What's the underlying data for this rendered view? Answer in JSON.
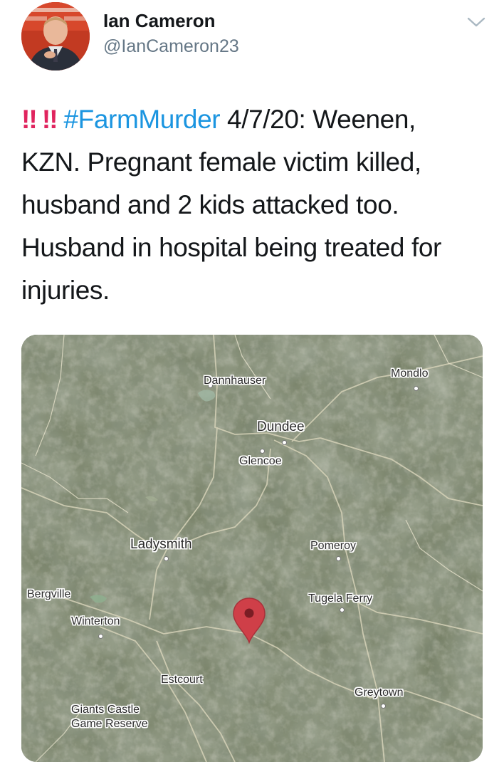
{
  "user": {
    "display_name": "Ian Cameron",
    "handle": "@IanCameron23"
  },
  "tweet": {
    "bang": "!! !!",
    "hashtag": "#FarmMurder",
    "line1_rest": " 4/7/20: Weenen,",
    "line2": "KZN. Pregnant female victim killed,",
    "line3": "husband and 2 kids attacked too.",
    "line4": "Husband in hospital being treated for",
    "line5": "injuries."
  },
  "map": {
    "labels": {
      "dannhauser": "Dannhauser",
      "mondlo": "Mondlo",
      "dundee": "Dundee",
      "glencoe": "Glencoe",
      "ladysmith": "Ladysmith",
      "pomeroy": "Pomeroy",
      "bergville": "Bergville",
      "tugela_ferry": "Tugela Ferry",
      "winterton": "Winterton",
      "estcourt": "Estcourt",
      "greytown": "Greytown",
      "giants_castle_1": "Giants Castle",
      "giants_castle_2": "Game Reserve"
    },
    "pin_color": "#d0414a"
  },
  "colors": {
    "text": "#14171a",
    "secondary": "#657786",
    "hashtag": "#1b95e0",
    "alert": "#e0245e"
  },
  "icons": {
    "chevron": "chevron-down-icon",
    "pin": "map-pin-icon"
  }
}
